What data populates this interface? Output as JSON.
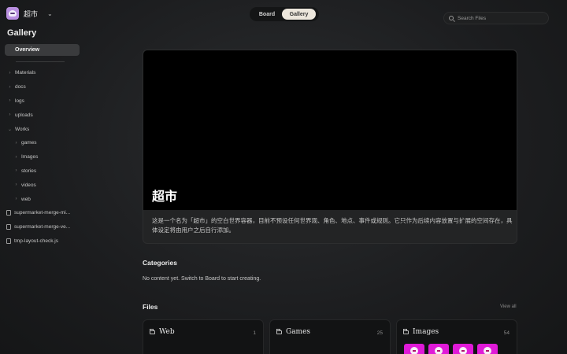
{
  "workspace": {
    "name": "超市"
  },
  "sidebar": {
    "title": "Gallery",
    "overview": "Overview",
    "tree": [
      {
        "label": "Materials",
        "type": "folder",
        "expanded": false,
        "level": 0
      },
      {
        "label": "docs",
        "type": "folder",
        "expanded": false,
        "level": 0
      },
      {
        "label": "logs",
        "type": "folder",
        "expanded": false,
        "level": 0
      },
      {
        "label": "uploads",
        "type": "folder",
        "expanded": false,
        "level": 0
      },
      {
        "label": "Works",
        "type": "folder",
        "expanded": true,
        "level": 0
      },
      {
        "label": "games",
        "type": "folder",
        "expanded": false,
        "level": 1
      },
      {
        "label": "Images",
        "type": "folder",
        "expanded": false,
        "level": 1
      },
      {
        "label": "stories",
        "type": "folder",
        "expanded": false,
        "level": 1
      },
      {
        "label": "videos",
        "type": "folder",
        "expanded": false,
        "level": 1
      },
      {
        "label": "web",
        "type": "folder",
        "expanded": false,
        "level": 1
      },
      {
        "label": "supermarket-merge-mi...",
        "type": "file",
        "level": 0
      },
      {
        "label": "supermarket-merge-ve...",
        "type": "file",
        "level": 0
      },
      {
        "label": "tmp-layout-check.js",
        "type": "file",
        "level": 0
      }
    ]
  },
  "topbar": {
    "tabs": {
      "board": "Board",
      "gallery": "Gallery"
    },
    "active_tab": "Gallery",
    "search_placeholder": "Search Files"
  },
  "hero": {
    "title": "超市",
    "description": "这是一个名为「超市」的空白世界容器，目前不预设任何世界观、角色、地点、事件或规则。它只作为后续内容放置与扩展的空间存在，具体设定将由用户之后自行添加。"
  },
  "categories": {
    "title": "Categories",
    "empty_text": "No content yet. Switch to Board to start creating."
  },
  "files": {
    "title": "Files",
    "view_all": "View all",
    "cards": [
      {
        "name": "Web",
        "count": "1"
      },
      {
        "name": "Games",
        "count": "25"
      },
      {
        "name": "Images",
        "count": "54"
      }
    ]
  },
  "colors": {
    "accent_pink": "#e01ad8",
    "active_tab_bg": "#ece6dc"
  }
}
